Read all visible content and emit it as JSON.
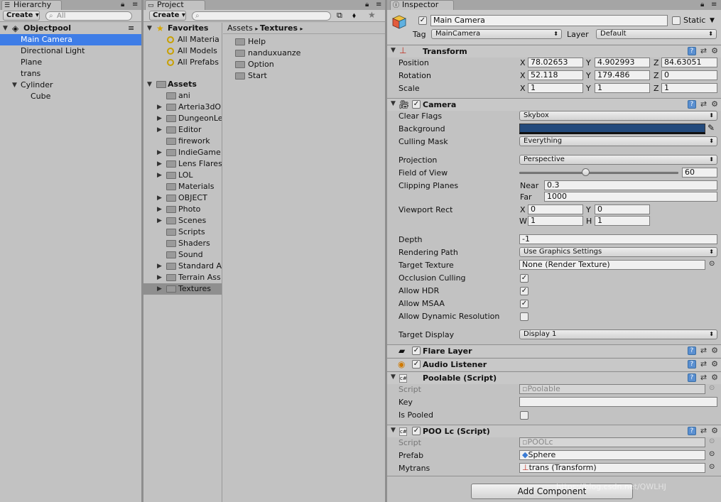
{
  "colors": {
    "selection": "#3e7de7",
    "background_swatch": "#234a7c",
    "panel": "#c2c2c2"
  },
  "hierarchy": {
    "tab": "Hierarchy",
    "create": "Create",
    "search_placeholder": "All",
    "scene": "Objectpool",
    "items": [
      "Main Camera",
      "Directional Light",
      "Plane",
      "trans",
      "Cylinder",
      "Cube"
    ]
  },
  "project": {
    "tab": "Project",
    "create": "Create",
    "favorites_label": "Favorites",
    "favorites": [
      "All Materia",
      "All Models",
      "All Prefabs"
    ],
    "assets_label": "Assets",
    "folders": [
      "ani",
      "Arteria3dO",
      "DungeonLe",
      "Editor",
      "firework",
      "IndieGame",
      "Lens Flares",
      "LOL",
      "Materials",
      "OBJECT",
      "Photo",
      "Scenes",
      "Scripts",
      "Shaders",
      "Sound",
      "Standard A",
      "Terrain Ass",
      "Textures"
    ],
    "breadcrumb": [
      "Assets",
      "Textures"
    ],
    "content": [
      "Help",
      "nanduxuanze",
      "Option",
      "Start"
    ]
  },
  "inspector": {
    "tab": "Inspector",
    "name": "Main Camera",
    "static_label": "Static",
    "tag_label": "Tag",
    "tag": "MainCamera",
    "layer_label": "Layer",
    "layer": "Default",
    "transform": {
      "title": "Transform",
      "position_label": "Position",
      "rotation_label": "Rotation",
      "scale_label": "Scale",
      "axes": [
        "X",
        "Y",
        "Z"
      ],
      "position": [
        "78.02653",
        "4.902993",
        "84.63051"
      ],
      "rotation": [
        "52.118",
        "179.486",
        "0"
      ],
      "scale": [
        "1",
        "1",
        "1"
      ]
    },
    "camera": {
      "title": "Camera",
      "clear_flags_label": "Clear Flags",
      "clear_flags": "Skybox",
      "background_label": "Background",
      "culling_mask_label": "Culling Mask",
      "culling_mask": "Everything",
      "projection_label": "Projection",
      "projection": "Perspective",
      "fov_label": "Field of View",
      "fov": "60",
      "fov_fraction": 0.42,
      "clipping_label": "Clipping Planes",
      "near_label": "Near",
      "near": "0.3",
      "far_label": "Far",
      "far": "1000",
      "viewport_label": "Viewport Rect",
      "vx_label": "X",
      "vx": "0",
      "vy_label": "Y",
      "vy": "0",
      "vw_label": "W",
      "vw": "1",
      "vh_label": "H",
      "vh": "1",
      "depth_label": "Depth",
      "depth": "-1",
      "rendering_path_label": "Rendering Path",
      "rendering_path": "Use Graphics Settings",
      "target_texture_label": "Target Texture",
      "target_texture": "None (Render Texture)",
      "occlusion_label": "Occlusion Culling",
      "hdr_label": "Allow HDR",
      "msaa_label": "Allow MSAA",
      "dynres_label": "Allow Dynamic Resolution",
      "target_display_label": "Target Display",
      "target_display": "Display 1"
    },
    "flare_layer": "Flare Layer",
    "audio_listener": "Audio Listener",
    "poolable": {
      "title": "Poolable (Script)",
      "script_label": "Script",
      "script": "Poolable",
      "key_label": "Key",
      "key": "",
      "pooled_label": "Is Pooled"
    },
    "poolc": {
      "title": "POO Lc (Script)",
      "script_label": "Script",
      "script": "POOLc",
      "prefab_label": "Prefab",
      "prefab": "Sphere",
      "mytrans_label": "Mytrans",
      "mytrans": "trans (Transform)"
    },
    "add_component": "Add Component",
    "watermark": "https://blog.csdn.net/QWLHJ"
  }
}
